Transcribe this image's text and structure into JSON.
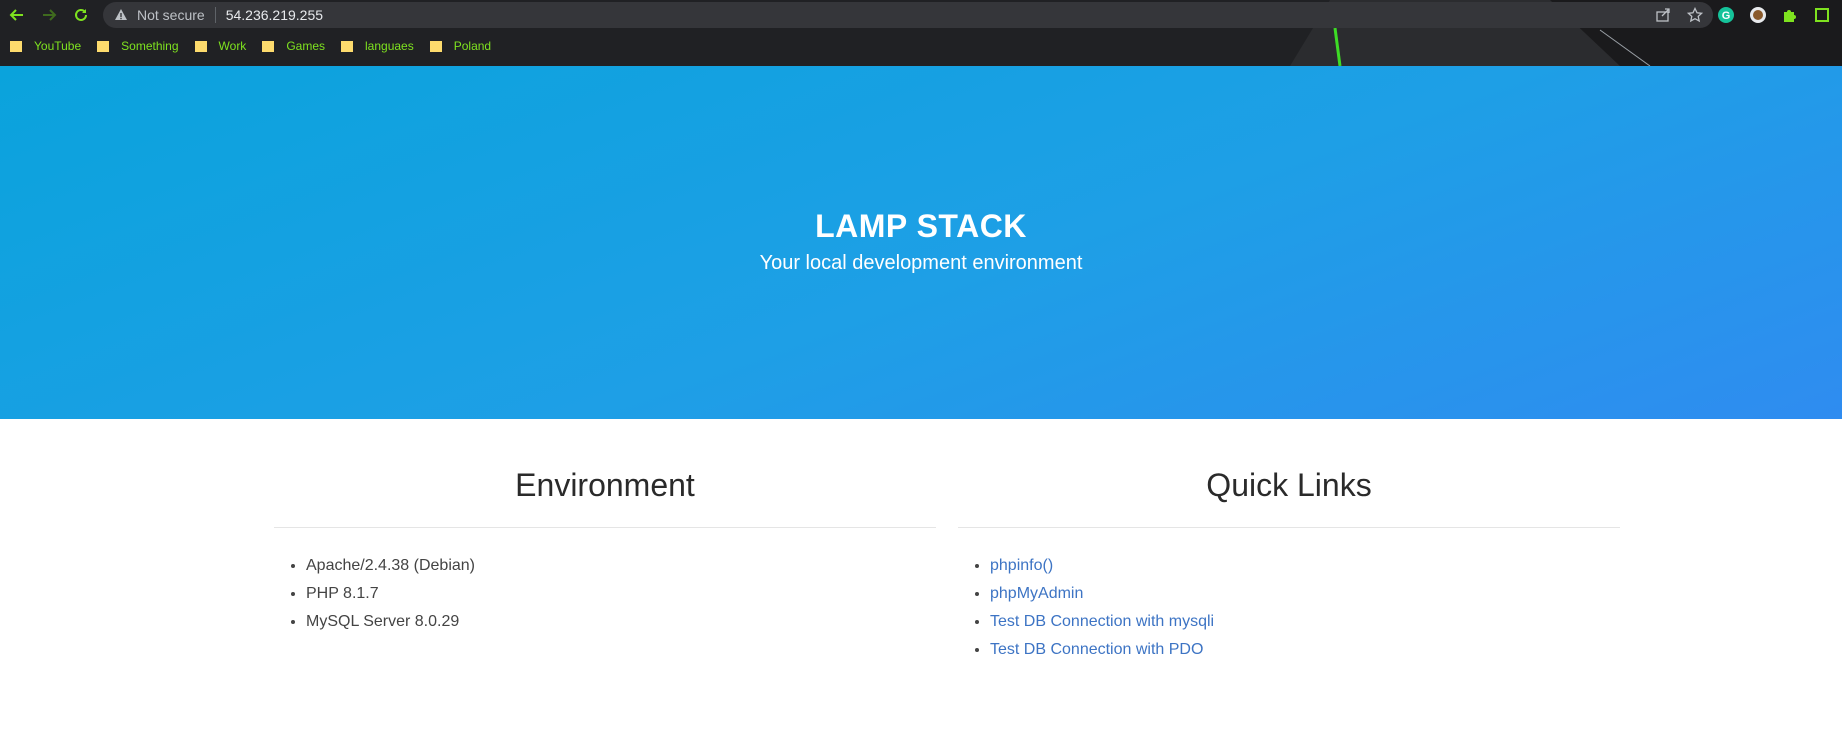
{
  "browser": {
    "not_secure": "Not secure",
    "url": "54.236.219.255",
    "bookmarks": [
      "YouTube",
      "Something",
      "Work",
      "Games",
      "languaes",
      "Poland"
    ]
  },
  "hero": {
    "title": "LAMP STACK",
    "subtitle": "Your local development environment"
  },
  "environment": {
    "heading": "Environment",
    "items": [
      "Apache/2.4.38 (Debian)",
      "PHP 8.1.7",
      "MySQL Server 8.0.29"
    ]
  },
  "quick_links": {
    "heading": "Quick Links",
    "links": [
      "phpinfo()",
      "phpMyAdmin",
      "Test DB Connection with mysqli",
      "Test DB Connection with PDO"
    ]
  },
  "colors": {
    "bookmark_text": "#7ee21f",
    "hero_start": "#0aa3dc",
    "hero_end": "#2f8cf0",
    "link": "#3d74c4"
  }
}
